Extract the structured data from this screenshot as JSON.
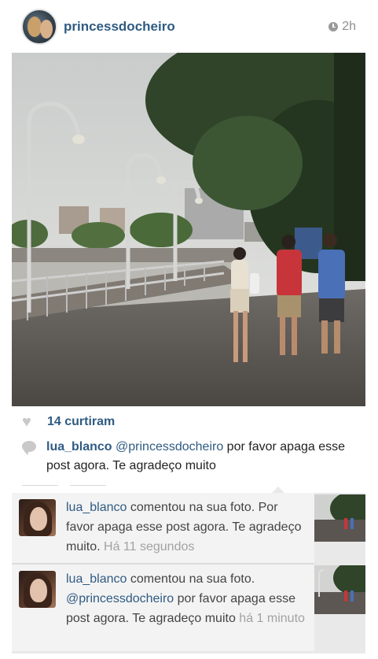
{
  "post": {
    "username": "princessdocheiro",
    "time": "2h",
    "likes_text": "14 curtiram"
  },
  "comment": {
    "user": "lua_blanco",
    "mention": "@princessdocheiro",
    "text": " por favor apaga esse post agora. Te agradeço muito"
  },
  "notifications": [
    {
      "user": "lua_blanco",
      "action": " comentou na sua foto. Por favor apaga esse post agora. Te agradeço muito. ",
      "mention": "",
      "rest": "",
      "time": "Há 11 segundos"
    },
    {
      "user": "lua_blanco",
      "action": " comentou na sua foto. ",
      "mention": "@princessdocheiro",
      "rest": " por favor apaga esse post agora. Te agradeço muito ",
      "time": "há 1 minuto"
    }
  ],
  "icons": {
    "time": "clock-icon",
    "likes": "heart-icon",
    "comments": "comment-bubble-icon"
  },
  "colors": {
    "link": "#2f5b82",
    "muted": "#8e8e8e",
    "notification_bg": "#f3f3f3"
  }
}
